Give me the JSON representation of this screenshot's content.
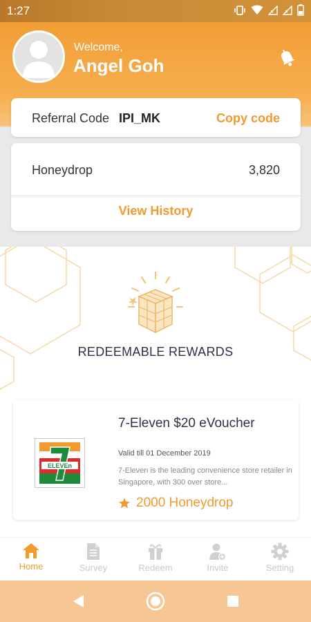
{
  "status_bar": {
    "time": "1:27"
  },
  "header": {
    "welcome": "Welcome,",
    "username": "Angel Goh"
  },
  "referral": {
    "label": "Referral Code",
    "code": "IPI_MK",
    "copy_label": "Copy code"
  },
  "points": {
    "label": "Honeydrop",
    "value": "3,820",
    "history_label": "View History"
  },
  "rewards": {
    "title": "REDEEMABLE REWARDS",
    "items": [
      {
        "title": "7-Eleven $20 eVoucher",
        "valid": "Valid till 01 December 2019",
        "description": "7-Eleven is the leading convenience store retailer in Singapore, with 300 over store...",
        "points": "2000 Honeydrop",
        "logo_text": "ELEVEn"
      }
    ]
  },
  "nav": [
    {
      "label": "Home",
      "icon": "home-icon",
      "active": true
    },
    {
      "label": "Survey",
      "icon": "document-icon",
      "active": false
    },
    {
      "label": "Redeem",
      "icon": "gift-icon",
      "active": false
    },
    {
      "label": "Invite",
      "icon": "add-user-icon",
      "active": false
    },
    {
      "label": "Setting",
      "icon": "gear-icon",
      "active": false
    }
  ],
  "colors": {
    "accent": "#f29a2e",
    "header": "#f4a440",
    "text_dark": "#2c3048",
    "nav_inactive": "#c9c9c9"
  }
}
